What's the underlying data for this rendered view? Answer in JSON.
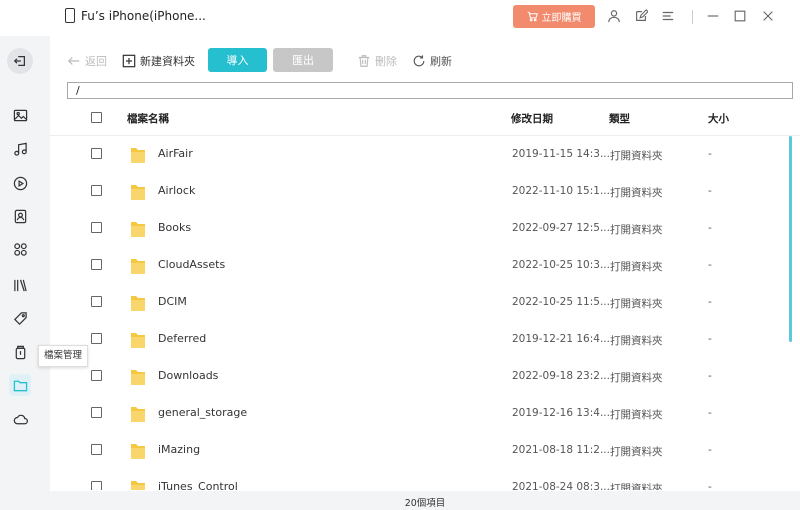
{
  "window": {
    "device_name": "Fu’s iPhone(iPhone...",
    "buy_label": "立即購買"
  },
  "sidebar": {
    "items": [
      {
        "icon": "photos-icon"
      },
      {
        "icon": "music-icon"
      },
      {
        "icon": "video-icon"
      },
      {
        "icon": "contacts-icon"
      },
      {
        "icon": "apps-icon"
      },
      {
        "icon": "books-icon"
      },
      {
        "icon": "tag-icon"
      },
      {
        "icon": "backup-icon"
      },
      {
        "icon": "folder-icon",
        "active": true
      },
      {
        "icon": "cloud-icon"
      }
    ],
    "tooltip": "檔案管理"
  },
  "toolbar": {
    "back_label": "返回",
    "new_folder_label": "新建資料夾",
    "import_label": "導入",
    "export_label": "匯出",
    "delete_label": "刪除",
    "refresh_label": "刷新"
  },
  "path": "/",
  "table": {
    "headers": {
      "name": "檔案名稱",
      "date": "修改日期",
      "type": "類型",
      "size": "大小"
    },
    "rows": [
      {
        "name": "AirFair",
        "date": "2019-11-15 14:3...",
        "type": "打開資料夾",
        "size": "-"
      },
      {
        "name": "Airlock",
        "date": "2022-11-10 15:1...",
        "type": "打開資料夾",
        "size": "-"
      },
      {
        "name": "Books",
        "date": "2022-09-27 12:5...",
        "type": "打開資料夾",
        "size": "-"
      },
      {
        "name": "CloudAssets",
        "date": "2022-10-25 10:3...",
        "type": "打開資料夾",
        "size": "-"
      },
      {
        "name": "DCIM",
        "date": "2022-10-25 11:5...",
        "type": "打開資料夾",
        "size": "-"
      },
      {
        "name": "Deferred",
        "date": "2019-12-21 16:4...",
        "type": "打開資料夾",
        "size": "-"
      },
      {
        "name": "Downloads",
        "date": "2022-09-18 23:2...",
        "type": "打開資料夾",
        "size": "-"
      },
      {
        "name": "general_storage",
        "date": "2019-12-16 13:4...",
        "type": "打開資料夾",
        "size": "-"
      },
      {
        "name": "iMazing",
        "date": "2021-08-18 11:2...",
        "type": "打開資料夾",
        "size": "-"
      },
      {
        "name": "iTunes_Control",
        "date": "2021-08-24 08:3...",
        "type": "打開資料夾",
        "size": "-"
      }
    ]
  },
  "footer": {
    "count": "20個項目"
  },
  "colors": {
    "accent": "#26bfcf",
    "buy": "#f28b6e",
    "folder": "#f5c842"
  }
}
